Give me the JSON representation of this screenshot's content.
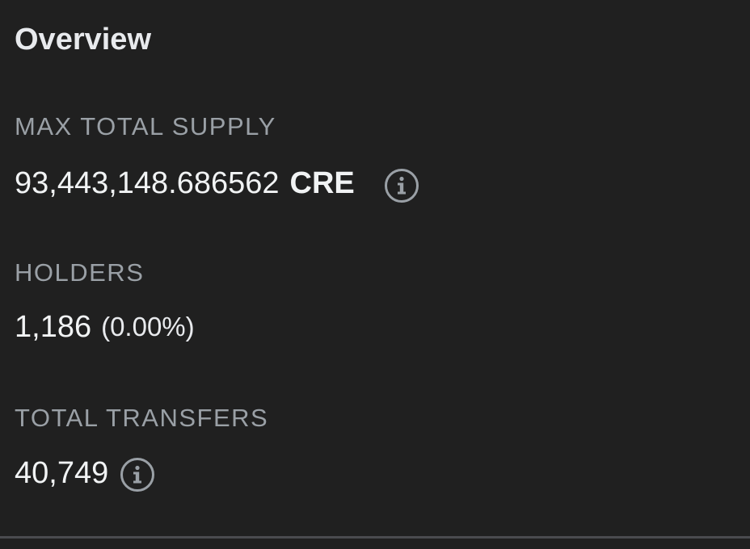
{
  "overview": {
    "title": "Overview",
    "max_total_supply": {
      "label": "MAX TOTAL SUPPLY",
      "amount": "93,443,148.686562",
      "unit": "CRE",
      "icon": "info-icon"
    },
    "holders": {
      "label": "HOLDERS",
      "count": "1,186",
      "percent": "(0.00%)"
    },
    "total_transfers": {
      "label": "TOTAL TRANSFERS",
      "count": "40,749",
      "icon": "info-icon"
    }
  },
  "colors": {
    "background": "#202020",
    "label": "#9aa0a6",
    "value": "#f1f3f4",
    "icon": "#9aa0a6",
    "divider": "#4a4b4f"
  }
}
